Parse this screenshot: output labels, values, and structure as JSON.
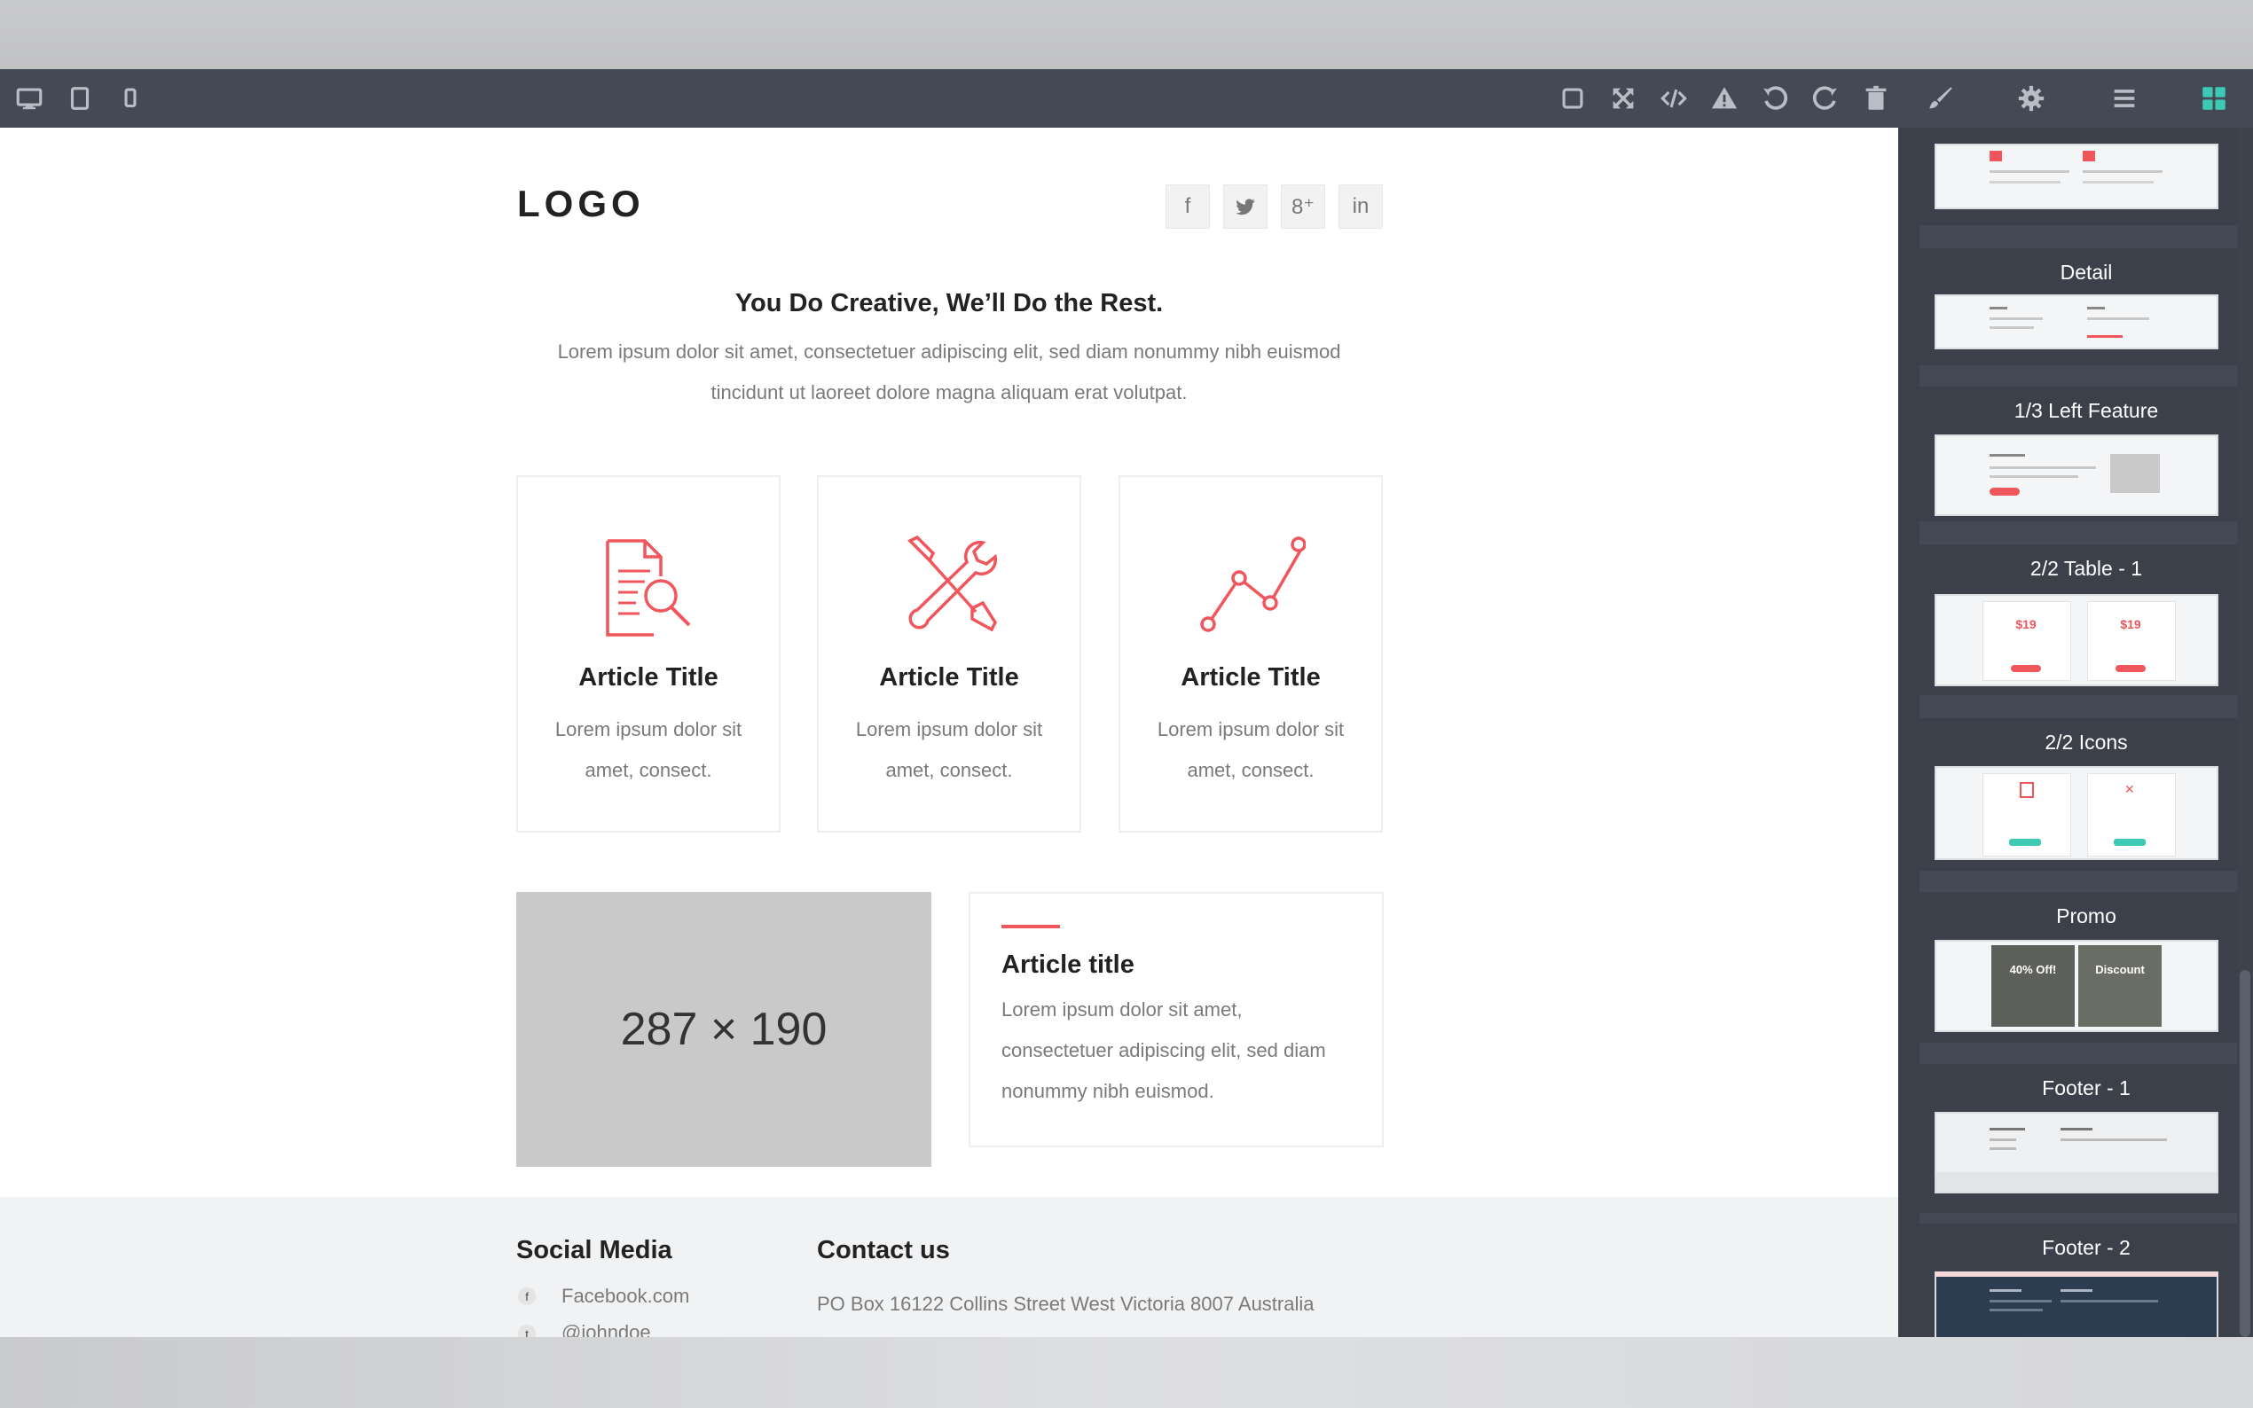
{
  "colors": {
    "toolbar": "#444a55",
    "panel": "#3b404a",
    "accent": "#f0565c",
    "active_icon": "#3dc9b3",
    "footer_bg": "#f1f2f4",
    "placeholder_bg": "#c9c9c9"
  },
  "toolbar": {
    "left_icons": [
      "desktop-icon",
      "tablet-icon",
      "mobile-icon"
    ],
    "right_icons": [
      "square-icon",
      "fullscreen-icon",
      "code-icon",
      "warning-icon",
      "undo-icon",
      "redo-icon",
      "trash-icon",
      "brush-icon",
      "gear-icon",
      "menu-icon",
      "blocks-icon"
    ]
  },
  "page": {
    "logo": "LOGO",
    "social": [
      "f",
      "t",
      "8⁺",
      "in"
    ],
    "hero_title": "You Do Creative, We’ll Do the Rest.",
    "hero_text": "Lorem ipsum dolor sit amet, consectetuer adipiscing elit, sed diam nonummy nibh euismod tincidunt ut laoreet dolore magna aliquam erat volutpat.",
    "cards": [
      {
        "icon": "document-search-icon",
        "title": "Article Title",
        "text": "Lorem ipsum dolor sit amet, consect."
      },
      {
        "icon": "tools-icon",
        "title": "Article Title",
        "text": "Lorem ipsum dolor sit amet, consect."
      },
      {
        "icon": "line-chart-icon",
        "title": "Article Title",
        "text": "Lorem ipsum dolor sit amet, consect."
      }
    ],
    "placeholder": "287 × 190",
    "article": {
      "title": "Article title",
      "text": "Lorem ipsum dolor sit amet, consectetuer adipiscing elit, sed diam nonummy nibh euismod."
    },
    "footer": {
      "social_title": "Social Media",
      "social_links": [
        "Facebook.com",
        "@johndoe"
      ],
      "contact_title": "Contact us",
      "address": "PO Box 16122 Collins Street West Victoria 8007 Australia"
    }
  },
  "panel": {
    "blocks": [
      {
        "label": "Detail"
      },
      {
        "label": "1/3 Left Feature"
      },
      {
        "label": "2/2 Table - 1"
      },
      {
        "label": "2/2 Icons"
      },
      {
        "label": "Promo"
      },
      {
        "label": "Footer - 1"
      },
      {
        "label": "Footer - 2"
      }
    ],
    "table_prices": [
      "$19",
      "$19"
    ],
    "promo_tiles": [
      "40% Off!",
      "Discount"
    ]
  }
}
